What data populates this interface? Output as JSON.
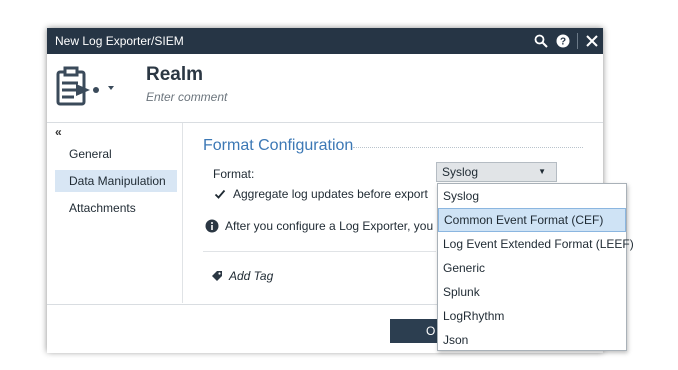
{
  "window": {
    "title": "New Log Exporter/SIEM"
  },
  "header": {
    "name": "Realm",
    "comment_placeholder": "Enter comment"
  },
  "nav": {
    "collapse_glyph": "«",
    "items": [
      {
        "label": "General"
      },
      {
        "label": "Data Manipulation",
        "active": true
      },
      {
        "label": "Attachments"
      }
    ]
  },
  "main": {
    "section_title": "Format Configuration",
    "format_label": "Format:",
    "format_value": "Syslog",
    "aggregate_label": "Aggregate log updates before export",
    "aggregate_checked": true,
    "info_text": "After you configure a Log Exporter, you r",
    "add_tag_label": "Add Tag"
  },
  "footer": {
    "ok_label": "O"
  },
  "dropdown": {
    "options": [
      "Syslog",
      "Common Event Format (CEF)",
      "Log Event Extended Format (LEEF)",
      "Generic",
      "Splunk",
      "LogRhythm",
      "Json"
    ],
    "highlighted": "Common Event Format (CEF)"
  },
  "colors": {
    "titlebar": "#263545",
    "accent": "#3c78b5",
    "nav_active": "#d8e6f4",
    "ok_button": "#2c3e50"
  },
  "icons": [
    "search-icon",
    "help-icon",
    "close-icon",
    "log-exporter-icon",
    "check-icon",
    "info-icon",
    "tag-icon"
  ]
}
